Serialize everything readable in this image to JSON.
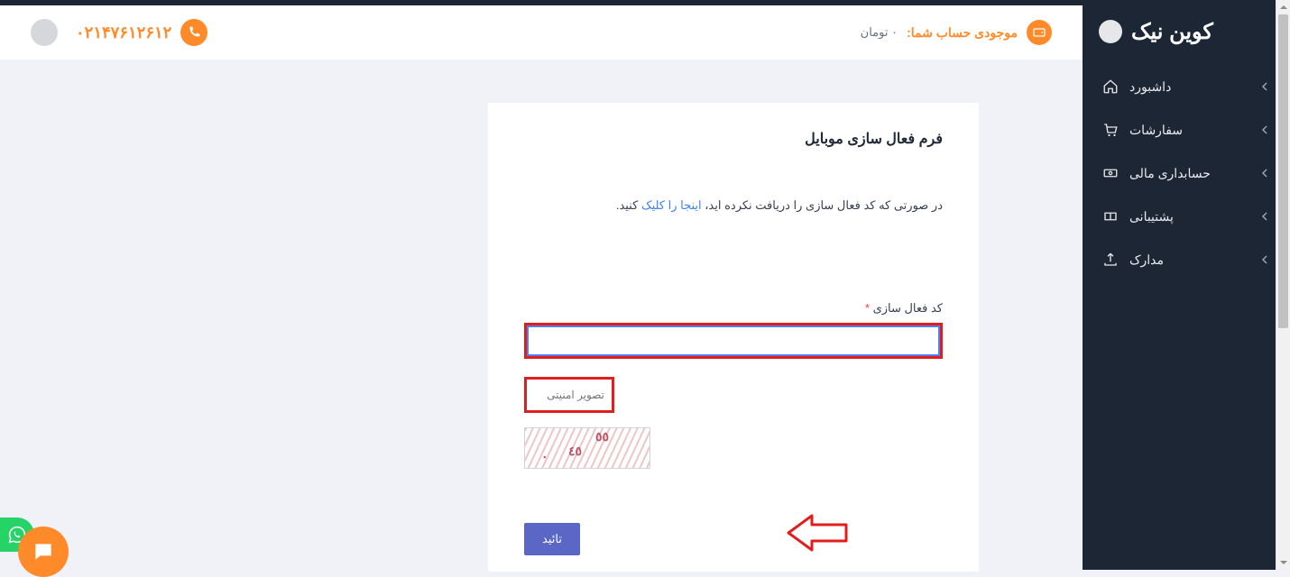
{
  "brand": {
    "name": "کوین نیک"
  },
  "sidebar": {
    "items": [
      {
        "label": "داشبورد",
        "icon": "home-icon"
      },
      {
        "label": "سفارشات",
        "icon": "cart-icon"
      },
      {
        "label": "حسابداری مالی",
        "icon": "cash-icon"
      },
      {
        "label": "پشتیبانی",
        "icon": "ticket-icon"
      },
      {
        "label": "مدارک",
        "icon": "upload-icon"
      }
    ]
  },
  "topbar": {
    "balance_label": "موجودی حساب شما:",
    "balance_amount": "۰ تومان",
    "phone": "۰۲۱۴۷۶۱۲۶۱۲"
  },
  "form": {
    "title": "فرم فعال سازی موبایل",
    "desc_pre": "در صورتی که کد فعال سازی را دریافت نکرده اید،",
    "desc_link": "اینجا را کلیک",
    "desc_post": "کنید.",
    "code_label": "کد فعال سازی",
    "required_marker": "*",
    "security_placeholder": "تصویر امنیتی",
    "submit_label": "تائید",
    "captcha": {
      "d1": "٥٥",
      "d2": "٤٥",
      "d3": "۰"
    }
  }
}
